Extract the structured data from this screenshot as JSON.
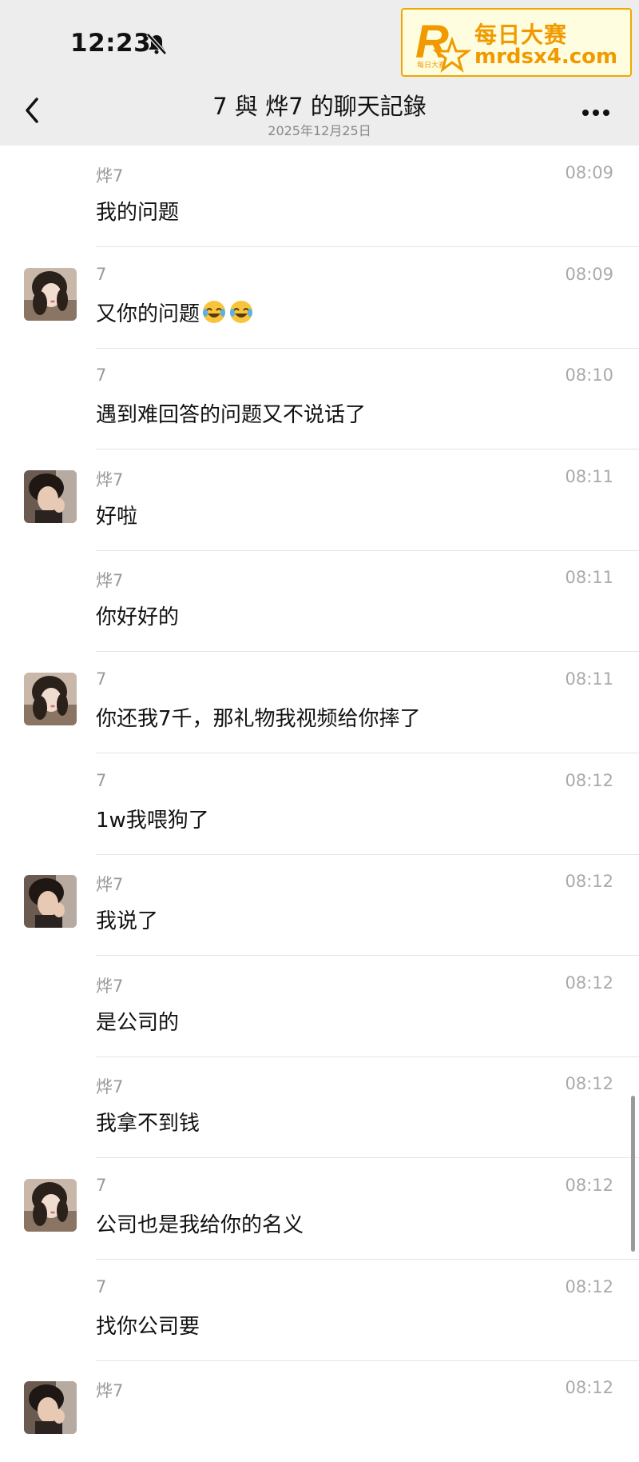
{
  "status_bar": {
    "time": "12:23"
  },
  "watermark": {
    "line1": "每日大赛",
    "line2": "mrdsx4.com",
    "logo_letter": "R",
    "logo_small": "每日大赛"
  },
  "header": {
    "title": "7 與 烨7 的聊天記錄",
    "date": "2025年12月25日"
  },
  "messages": [
    {
      "sender": "烨7",
      "time": "08:09",
      "text": "我的问题",
      "avatar": ""
    },
    {
      "sender": "7",
      "time": "08:09",
      "text": "又你的问题",
      "emojis": [
        "face-with-tears-of-joy",
        "face-with-tears-of-joy"
      ],
      "avatar": "girl"
    },
    {
      "sender": "7",
      "time": "08:10",
      "text": "遇到难回答的问题又不说话了",
      "avatar": ""
    },
    {
      "sender": "烨7",
      "time": "08:11",
      "text": "好啦",
      "avatar": "boy"
    },
    {
      "sender": "烨7",
      "time": "08:11",
      "text": "你好好的",
      "avatar": ""
    },
    {
      "sender": "7",
      "time": "08:11",
      "text": "你还我7千，那礼物我视频给你摔了",
      "avatar": "girl"
    },
    {
      "sender": "7",
      "time": "08:12",
      "text": "1w我喂狗了",
      "avatar": ""
    },
    {
      "sender": "烨7",
      "time": "08:12",
      "text": "我说了",
      "avatar": "boy"
    },
    {
      "sender": "烨7",
      "time": "08:12",
      "text": "是公司的",
      "avatar": ""
    },
    {
      "sender": "烨7",
      "time": "08:12",
      "text": "我拿不到钱",
      "avatar": ""
    },
    {
      "sender": "7",
      "time": "08:12",
      "text": "公司也是我给你的名义",
      "avatar": "girl"
    },
    {
      "sender": "7",
      "time": "08:12",
      "text": "找你公司要",
      "avatar": ""
    },
    {
      "sender": "烨7",
      "time": "08:12",
      "text": "",
      "avatar": "boy"
    }
  ],
  "colors": {
    "bar_bg": "#ededed",
    "accent": "#f09a00",
    "text": "#111111",
    "meta": "#999999"
  }
}
